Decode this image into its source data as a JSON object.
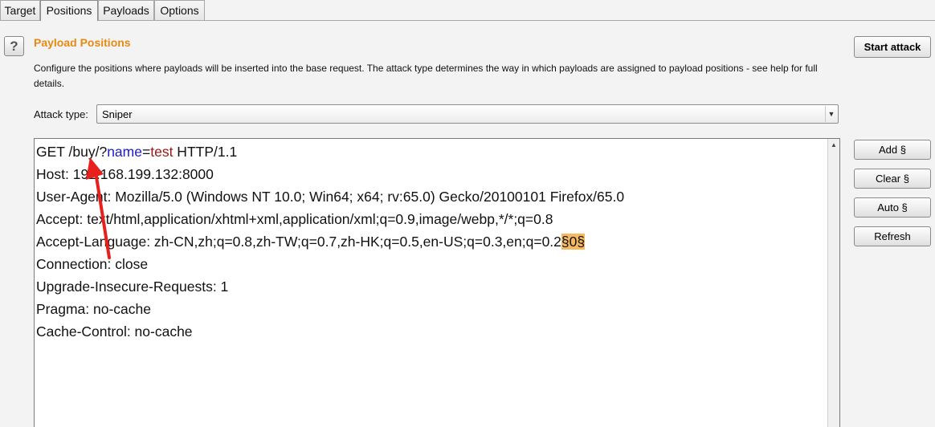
{
  "tabs": [
    {
      "label": "Target"
    },
    {
      "label": "Positions"
    },
    {
      "label": "Payloads"
    },
    {
      "label": "Options"
    }
  ],
  "help": {
    "icon_label": "?",
    "icon": "help-icon"
  },
  "section": {
    "title": "Payload Positions",
    "description": "Configure the positions where payloads will be inserted into the base request. The attack type determines the way in which payloads are assigned to payload positions - see help for full details."
  },
  "start_attack_label": "Start attack",
  "attack_type": {
    "label": "Attack type:",
    "value": "Sniper",
    "arrow_glyph": "▼"
  },
  "request": {
    "line1": {
      "prefix": "GET /buy/?",
      "param": "name",
      "eq": "=",
      "value": "test",
      "suffix": " HTTP/1.1"
    },
    "line2": "Host: 192.168.199.132:8000",
    "line3": "User-Agent: Mozilla/5.0 (Windows NT 10.0; Win64; x64; rv:65.0) Gecko/20100101 Firefox/65.0",
    "line4": "Accept: text/html,application/xhtml+xml,application/xml;q=0.9,image/webp,*/*;q=0.8",
    "line5": {
      "text": "Accept-Language: zh-CN,zh;q=0.8,zh-TW;q=0.7,zh-HK;q=0.5,en-US;q=0.3,en;q=0.2",
      "marker": "§0§"
    },
    "line6": "Connection: close",
    "line7": "Upgrade-Insecure-Requests: 1",
    "line8": "Pragma: no-cache",
    "line9": "Cache-Control: no-cache"
  },
  "scroll_up_glyph": "▲",
  "side_buttons": {
    "add": "Add §",
    "clear": "Clear §",
    "auto": "Auto §",
    "refresh": "Refresh"
  },
  "colors": {
    "title_orange": "#e58a12",
    "param_blue": "#1c1cc9",
    "value_red": "#a01515",
    "marker_bg": "#f5b95f",
    "annotation_red": "#e8201c"
  }
}
